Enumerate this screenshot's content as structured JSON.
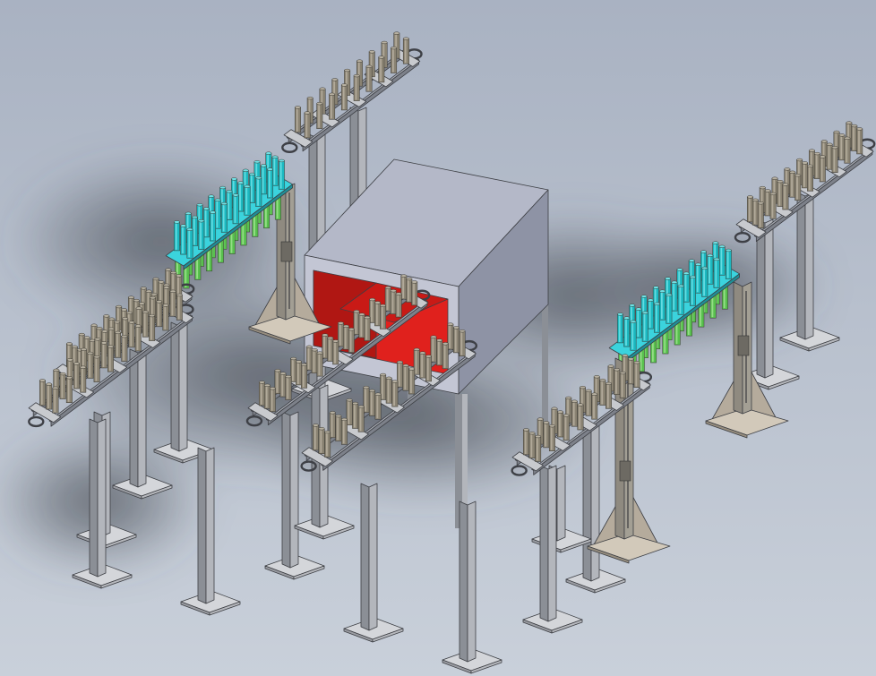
{
  "scene": {
    "background_top": "#a9b2c2",
    "background_bottom": "#c9d0da",
    "shadow_color": "#4a5058",
    "components": [
      {
        "name": "oven-chamber",
        "kind": "cabinet"
      },
      {
        "name": "conveyor-left-upper",
        "kind": "rack"
      },
      {
        "name": "conveyor-left-lower",
        "kind": "rack"
      },
      {
        "name": "conveyor-center-left",
        "kind": "rack"
      },
      {
        "name": "conveyor-center-front",
        "kind": "rack"
      },
      {
        "name": "conveyor-right-front",
        "kind": "rack"
      },
      {
        "name": "conveyor-right-upper",
        "kind": "rack"
      },
      {
        "name": "transfer-lift-left",
        "kind": "lift"
      },
      {
        "name": "transfer-lift-right",
        "kind": "lift"
      }
    ],
    "colors": {
      "frame": "#7d818a",
      "frame_light": "#a7abb3",
      "post": "#8b8f96",
      "post_light": "#b3b6bc",
      "base_plate": "#d4d6da",
      "tube": "#8a8373",
      "tube_light": "#b7b0a0",
      "tube_cyan": "#1cb8c0",
      "tube_cyan_light": "#6fe2e6",
      "tube_green": "#58c04e",
      "tube_green_light": "#9fe28f",
      "tray_cyan": "#3bd3dd",
      "cabinet_top": "#b4b8c8",
      "cabinet_front": "#c3c6d4",
      "cabinet_side": "#8e93a5",
      "opening_red": "#e0211d",
      "opening_red_dark": "#b01713",
      "lift_frame": "#a39f94"
    }
  }
}
